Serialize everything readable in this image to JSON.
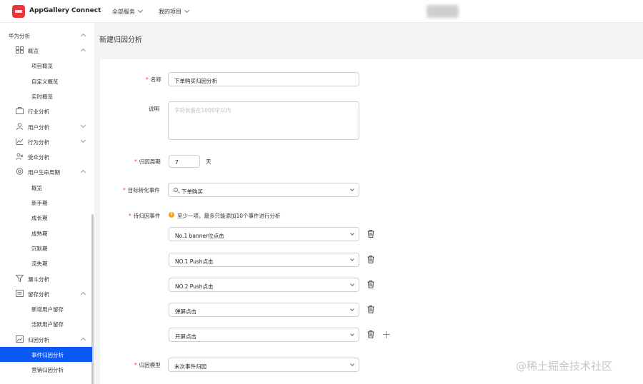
{
  "header": {
    "app_title": "AppGallery Connect",
    "nav": [
      "全部服务",
      "我的项目"
    ]
  },
  "sidebar": {
    "section": "华为分析",
    "items": [
      {
        "label": "概览",
        "level": 1,
        "icon": "grid-icon",
        "arrow": "up"
      },
      {
        "label": "项目概览",
        "level": 2
      },
      {
        "label": "自定义概览",
        "level": 2
      },
      {
        "label": "实时概览",
        "level": 2
      },
      {
        "label": "行业分析",
        "level": 1,
        "icon": "briefcase-icon"
      },
      {
        "label": "用户分析",
        "level": 1,
        "icon": "user-icon",
        "arrow": "down"
      },
      {
        "label": "行为分析",
        "level": 1,
        "icon": "trend-icon",
        "arrow": "down"
      },
      {
        "label": "受众分析",
        "level": 1,
        "icon": "audience-icon"
      },
      {
        "label": "用户生命周期",
        "level": 1,
        "icon": "lifecycle-icon",
        "arrow": "up"
      },
      {
        "label": "概览",
        "level": 2
      },
      {
        "label": "新手期",
        "level": 2
      },
      {
        "label": "成长期",
        "level": 2
      },
      {
        "label": "成熟期",
        "level": 2
      },
      {
        "label": "沉默期",
        "level": 2
      },
      {
        "label": "流失期",
        "level": 2
      },
      {
        "label": "漏斗分析",
        "level": 1,
        "icon": "funnel-icon"
      },
      {
        "label": "留存分析",
        "level": 1,
        "icon": "retention-icon",
        "arrow": "up"
      },
      {
        "label": "新增用户留存",
        "level": 2
      },
      {
        "label": "活跃用户留存",
        "level": 2
      },
      {
        "label": "归因分析",
        "level": 1,
        "icon": "attribution-icon",
        "arrow": "up"
      },
      {
        "label": "事件归因分析",
        "level": 2,
        "active": true
      },
      {
        "label": "营销归因分析",
        "level": 2
      }
    ]
  },
  "page": {
    "title": "新建归因分析"
  },
  "form": {
    "name_label": "名称",
    "name_value": "下单购买归因分析",
    "desc_label": "说明",
    "desc_placeholder": "字符长度在1000字以内",
    "period_label": "归因周期",
    "period_value": "7",
    "period_unit": "天",
    "target_label": "目标转化事件",
    "target_value": "下单购买",
    "pending_label": "待归因事件",
    "pending_hint": "至少一项，最多只能添加10个事件进行分析",
    "pending_events": [
      "No.1 banner位点击",
      "NO.1 Push点击",
      "NO.2 Push点击",
      "弹屏点击",
      "开屏点击"
    ],
    "model_label": "归因模型",
    "model_value": "末次事件归因"
  },
  "watermark": "@稀土掘金技术社区",
  "colors": {
    "brand": "#e8363d",
    "active": "#0a59f7",
    "required": "#e84026",
    "hint": "#f5a623"
  }
}
